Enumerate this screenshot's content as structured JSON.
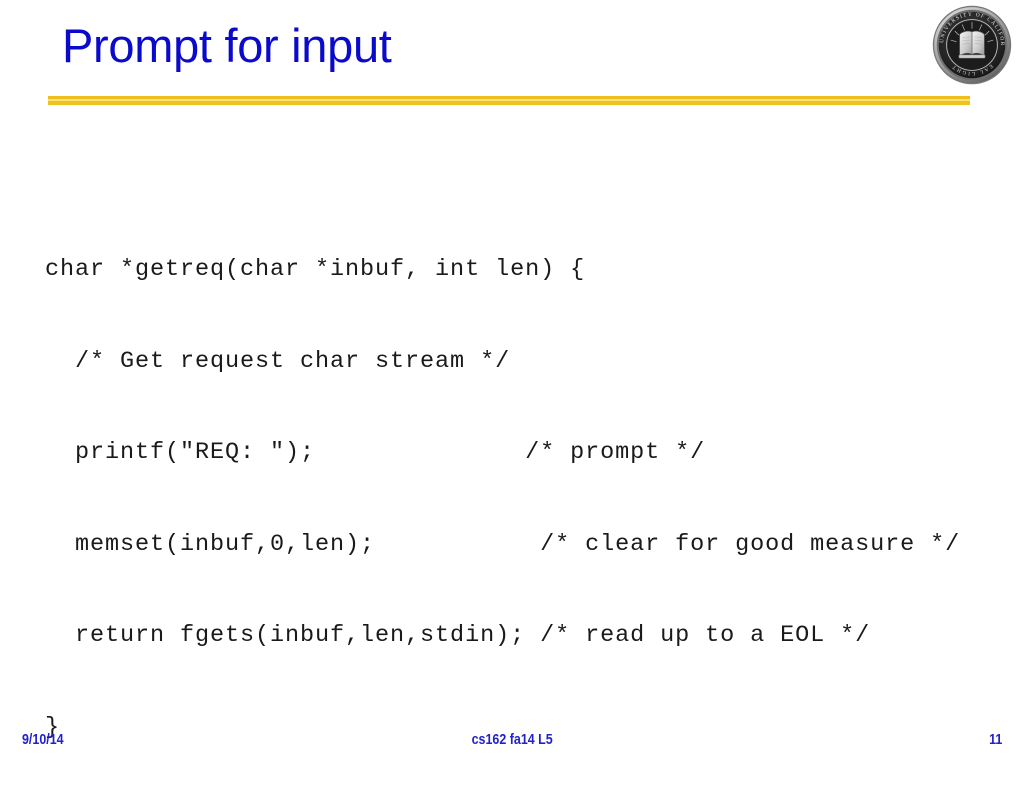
{
  "slide": {
    "title": "Prompt for input",
    "accent_color": "#EFC31E",
    "title_color": "#0A0ACC",
    "footer_color": "#2222CC",
    "background_color": "#FFFFFF"
  },
  "logo": {
    "name": "uc-berkeley-seal",
    "ring_text_top": "THE UNIVERSITY OF CALIFORNIA",
    "ring_text_bottom": "LET THERE BE LIGHT",
    "motto_fragment": "EAL",
    "color": "#9a9a9a"
  },
  "code": {
    "language": "c",
    "lines": [
      "char *getreq(char *inbuf, int len) {",
      "  /* Get request char stream */",
      "  printf(\"REQ: \");              /* prompt */",
      "  memset(inbuf,0,len);           /* clear for good measure */",
      "  return fgets(inbuf,len,stdin); /* read up to a EOL */",
      "}"
    ]
  },
  "footer": {
    "date": "9/10/14",
    "course": "cs162 fa14 L5",
    "page_number": "11"
  }
}
